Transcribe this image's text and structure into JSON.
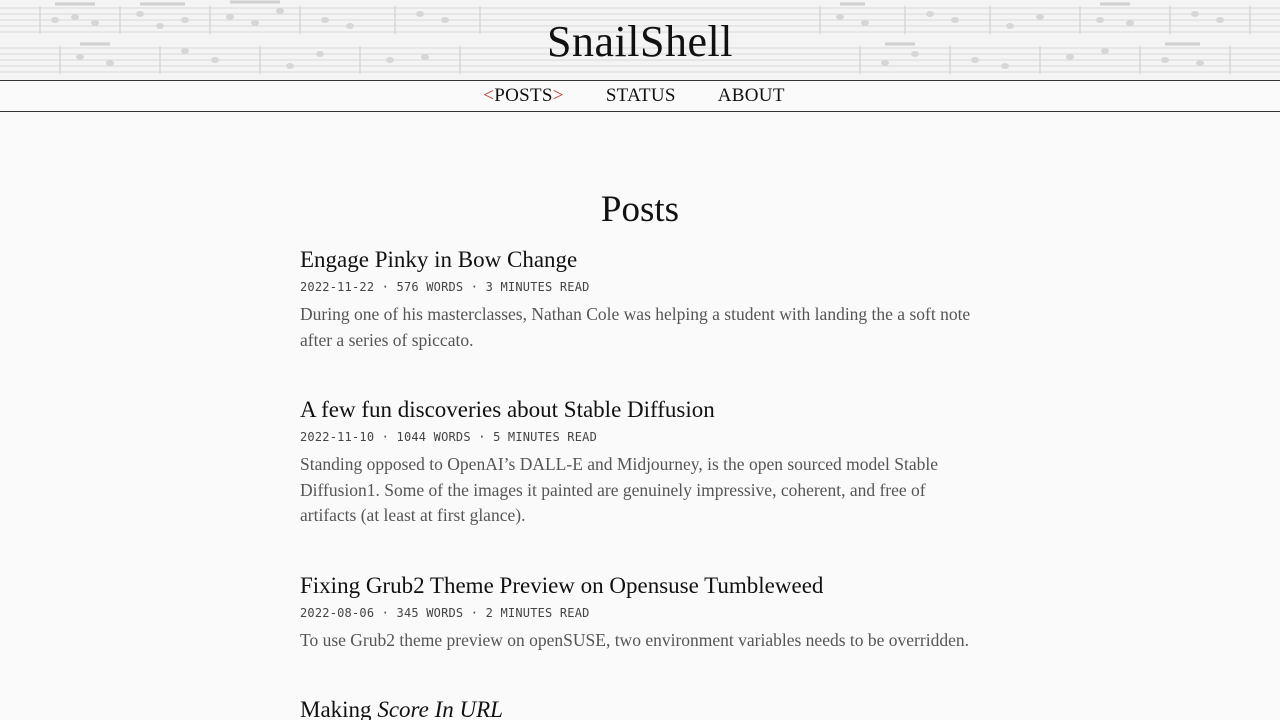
{
  "site": {
    "title": "SnailShell"
  },
  "nav": {
    "items": [
      {
        "label": "POSTS",
        "active": true,
        "bracket_left": "<",
        "bracket_right": ">"
      },
      {
        "label": "STATUS",
        "active": false
      },
      {
        "label": "ABOUT",
        "active": false
      }
    ]
  },
  "page": {
    "heading": "Posts"
  },
  "posts": [
    {
      "title": "Engage Pinky in Bow Change",
      "date": "2022-11-22",
      "words": "576 WORDS",
      "read_time": "3 MINUTES READ",
      "summary": "During one of his masterclasses, Nathan Cole was helping a student with landing the a soft note after a series of spiccato."
    },
    {
      "title": "A few fun discoveries about Stable Diffusion",
      "date": "2022-11-10",
      "words": "1044 WORDS",
      "read_time": "5 MINUTES READ",
      "summary": "Standing opposed to OpenAI’s DALL-E and Midjourney, is the open sourced model Stable Diffusion1. Some of the images it painted are genuinely impressive, coherent, and free of artifacts (at least at first glance)."
    },
    {
      "title": "Fixing Grub2 Theme Preview on Opensuse Tumbleweed",
      "date": "2022-08-06",
      "words": "345 WORDS",
      "read_time": "2 MINUTES READ",
      "summary": "To use Grub2 theme preview on openSUSE, two environment variables needs to be overridden."
    },
    {
      "title_prefix": "Making ",
      "title_italic": "Score In URL",
      "partial": true
    }
  ],
  "meta_separator": " · ",
  "colors": {
    "accent": "#c0392b",
    "text": "#222222",
    "muted": "#555555",
    "background": "#fafafa"
  }
}
